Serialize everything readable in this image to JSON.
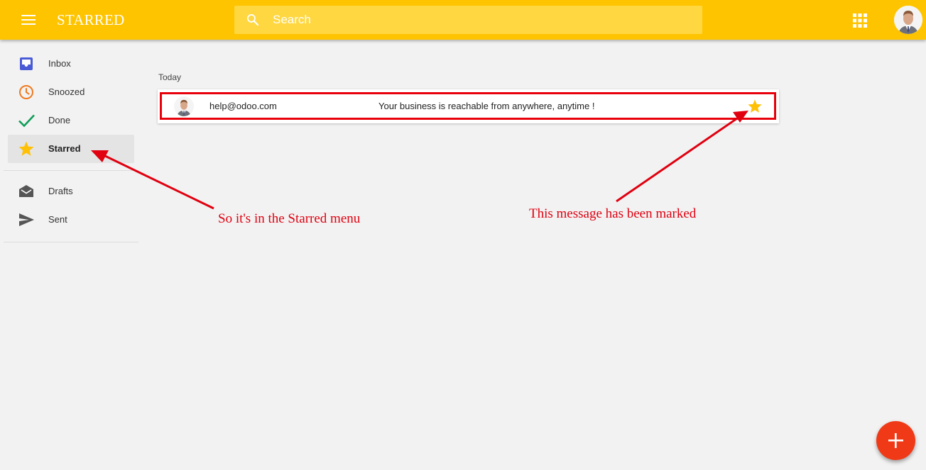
{
  "app": {
    "title": "STARRED"
  },
  "search": {
    "placeholder": "Search"
  },
  "sidebar": {
    "items": [
      {
        "label": "Inbox",
        "icon": "inbox-icon",
        "color": "#4a5bd6"
      },
      {
        "label": "Snoozed",
        "icon": "clock-icon",
        "color": "#ef7a21"
      },
      {
        "label": "Done",
        "icon": "checkmark-icon",
        "color": "#0f9d58"
      },
      {
        "label": "Starred",
        "icon": "star-icon",
        "color": "#ffc107",
        "active": true
      },
      {
        "label": "Drafts",
        "icon": "drafts-icon",
        "color": "#555555"
      },
      {
        "label": "Sent",
        "icon": "send-icon",
        "color": "#555555"
      }
    ]
  },
  "main": {
    "section_label": "Today",
    "messages": [
      {
        "from": "help@odoo.com",
        "subject": "Your business is reachable from anywhere, anytime !",
        "starred": true
      }
    ]
  },
  "annotations": {
    "note_menu": "So it's in the Starred menu",
    "note_message": "This message has been marked"
  },
  "colors": {
    "topbar": "#ffc400",
    "search_bg": "#ffd740",
    "annotation_red": "#e00010",
    "fab": "#f03a17",
    "star": "#ffc107"
  }
}
